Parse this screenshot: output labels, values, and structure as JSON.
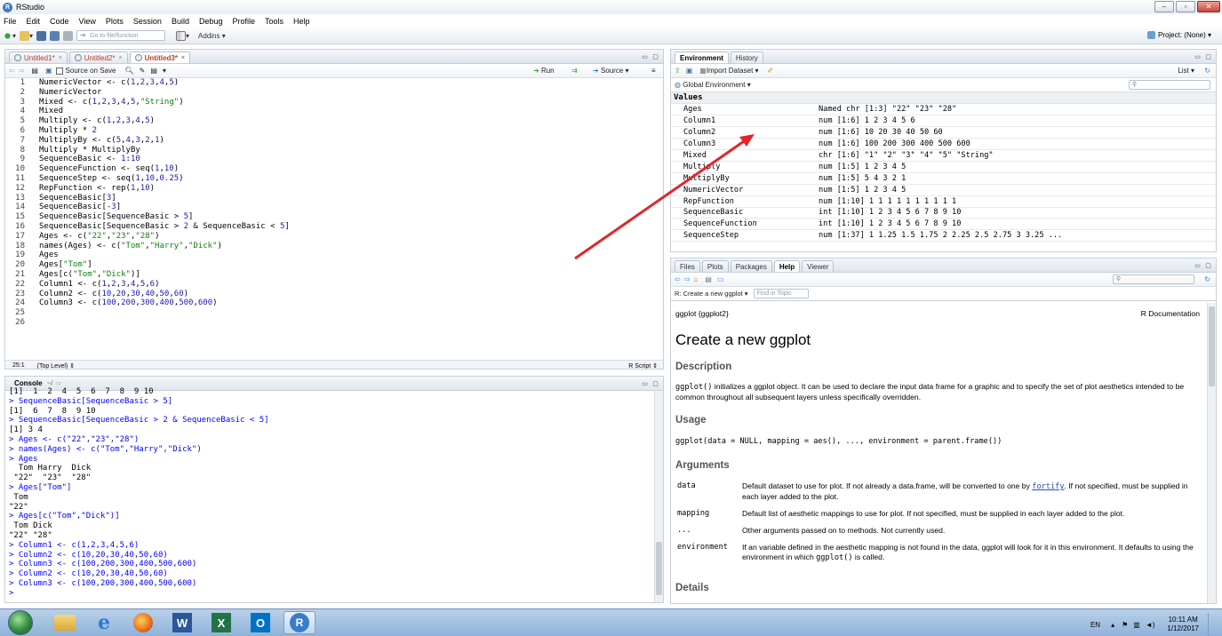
{
  "window": {
    "title": "RStudio",
    "buttons": {
      "min": "–",
      "max": "▫",
      "close": "✕"
    }
  },
  "menu": [
    "File",
    "Edit",
    "Code",
    "View",
    "Plots",
    "Session",
    "Build",
    "Debug",
    "Profile",
    "Tools",
    "Help"
  ],
  "toolbar": {
    "goto_placeholder": "Go to file/function",
    "addins": "Addins ▾",
    "project": "Project: (None) ▾"
  },
  "editor": {
    "tabs": [
      {
        "label": "Untitled1*",
        "active": false
      },
      {
        "label": "Untitled2*",
        "active": false
      },
      {
        "label": "Untitled3*",
        "active": true
      }
    ],
    "tab_close": "×",
    "toolbar": {
      "source_on_save": "Source on Save",
      "run": "Run",
      "source": "Source ▾"
    },
    "lines": [
      "NumericVector <- c(1,2,3,4,5)",
      "NumericVector",
      "Mixed <- c(1,2,3,4,5,\"String\")",
      "Mixed",
      "Multiply <- c(1,2,3,4,5)",
      "Multiply * 2",
      "MultiplyBy <- c(5,4,3,2,1)",
      "Multiply * MultiplyBy",
      "SequenceBasic <- 1:10",
      "SequenceFunction <- seq(1,10)",
      "SequenceStep <- seq(1,10,0.25)",
      "RepFunction <- rep(1,10)",
      "SequenceBasic[3]",
      "SequenceBasic[-3]",
      "SequenceBasic[SequenceBasic > 5]",
      "SequenceBasic[SequenceBasic > 2 & SequenceBasic < 5]",
      "Ages <- c(\"22\",\"23\",\"28\")",
      "names(Ages) <- c(\"Tom\",\"Harry\",\"Dick\")",
      "Ages",
      "Ages[\"Tom\"]",
      "Ages[c(\"Tom\",\"Dick\")]",
      "Column1 <- c(1,2,3,4,5,6)",
      "Column2 <- c(10,20,30,40,50,60)",
      "Column3 <- c(100,200,300,400,500,600)",
      "",
      ""
    ],
    "status": {
      "position": "25:1",
      "scope": "(Top Level) ⇕",
      "type": "R Script ⇕"
    }
  },
  "console": {
    "title": "Console",
    "path": "~/",
    "lines": [
      {
        "kind": "out",
        "text": "[1]  1  2  4  5  6  7  8  9 10"
      },
      {
        "kind": "cmd",
        "text": "> SequenceBasic[SequenceBasic > 5]"
      },
      {
        "kind": "out",
        "text": "[1]  6  7  8  9 10"
      },
      {
        "kind": "cmd",
        "text": "> SequenceBasic[SequenceBasic > 2 & SequenceBasic < 5]"
      },
      {
        "kind": "out",
        "text": "[1] 3 4"
      },
      {
        "kind": "cmd",
        "text": "> Ages <- c(\"22\",\"23\",\"28\")"
      },
      {
        "kind": "cmd",
        "text": "> names(Ages) <- c(\"Tom\",\"Harry\",\"Dick\")"
      },
      {
        "kind": "cmd",
        "text": "> Ages"
      },
      {
        "kind": "out",
        "text": "  Tom Harry  Dick"
      },
      {
        "kind": "out",
        "text": " \"22\"  \"23\"  \"28\""
      },
      {
        "kind": "cmd",
        "text": "> Ages[\"Tom\"]"
      },
      {
        "kind": "out",
        "text": " Tom"
      },
      {
        "kind": "out",
        "text": "\"22\""
      },
      {
        "kind": "cmd",
        "text": "> Ages[c(\"Tom\",\"Dick\")]"
      },
      {
        "kind": "out",
        "text": " Tom Dick"
      },
      {
        "kind": "out",
        "text": "\"22\" \"28\""
      },
      {
        "kind": "cmd",
        "text": "> Column1 <- c(1,2,3,4,5,6)"
      },
      {
        "kind": "cmd",
        "text": "> Column2 <- c(10,20,30,40,50,60)"
      },
      {
        "kind": "cmd",
        "text": "> Column3 <- c(100,200,300,400,500,600)"
      },
      {
        "kind": "cmd",
        "text": "> Column2 <- c(10,20,30,40,50,60)"
      },
      {
        "kind": "cmd",
        "text": "> Column3 <- c(100,200,300,400,500,600)"
      },
      {
        "kind": "cmd",
        "text": "> "
      }
    ]
  },
  "environment": {
    "tabs": [
      "Environment",
      "History"
    ],
    "import_dataset": "Import Dataset ▾",
    "list_view": "List ▾",
    "scope": "Global Environment ▾",
    "section": "Values",
    "rows": [
      {
        "name": "Ages",
        "value": "Named chr [1:3] \"22\" \"23\" \"28\""
      },
      {
        "name": "Column1",
        "value": "num [1:6] 1 2 3 4 5 6"
      },
      {
        "name": "Column2",
        "value": "num [1:6] 10 20 30 40 50 60"
      },
      {
        "name": "Column3",
        "value": "num [1:6] 100 200 300 400 500 600"
      },
      {
        "name": "Mixed",
        "value": "chr [1:6] \"1\" \"2\" \"3\" \"4\" \"5\" \"String\""
      },
      {
        "name": "Multiply",
        "value": "num [1:5] 1 2 3 4 5"
      },
      {
        "name": "MultiplyBy",
        "value": "num [1:5] 5 4 3 2 1"
      },
      {
        "name": "NumericVector",
        "value": "num [1:5] 1 2 3 4 5"
      },
      {
        "name": "RepFunction",
        "value": "num [1:10] 1 1 1 1 1 1 1 1 1 1"
      },
      {
        "name": "SequenceBasic",
        "value": "int [1:10] 1 2 3 4 5 6 7 8 9 10"
      },
      {
        "name": "SequenceFunction",
        "value": "int [1:10] 1 2 3 4 5 6 7 8 9 10"
      },
      {
        "name": "SequenceStep",
        "value": "num [1:37] 1 1.25 1.5 1.75 2 2.25 2.5 2.75 3 3.25 ..."
      }
    ]
  },
  "help": {
    "tabs": [
      "Files",
      "Plots",
      "Packages",
      "Help",
      "Viewer"
    ],
    "topic_select": "R: Create a new ggplot ▾",
    "find_placeholder": "Find in Topic",
    "header_left": "ggplot {ggplot2}",
    "header_right": "R Documentation",
    "title": "Create a new ggplot",
    "description_h": "Description",
    "description_code": "ggplot()",
    "description_text": " initializes a ggplot object. It can be used to declare the input data frame for a graphic and to specify the set of plot aesthetics intended to be common throughout all subsequent layers unless specifically overridden.",
    "usage_h": "Usage",
    "usage_code": "ggplot(data = NULL, mapping = aes(), ..., environment = parent.frame())",
    "arguments_h": "Arguments",
    "args": [
      {
        "name": "data",
        "pre": "Default dataset to use for plot. If not already a data.frame, will be converted to one by ",
        "link": "fortify",
        "post": ". If not specified, must be supplied in each layer added to the plot."
      },
      {
        "name": "mapping",
        "pre": "Default list of aesthetic mappings to use for plot. If not specified, must be supplied in each layer added to the plot.",
        "link": "",
        "post": ""
      },
      {
        "name": "...",
        "pre": "Other arguments passed on to methods. Not currently used.",
        "link": "",
        "post": ""
      },
      {
        "name": "environment",
        "pre": "If an variable defined in the aesthetic mapping is not found in the data, ggplot will look for it in this environment. It defaults to using the environment in which ",
        "link": "",
        "code": "ggplot()",
        "post": " is called."
      }
    ],
    "details_h": "Details"
  },
  "taskbar": {
    "lang": "EN",
    "time": "10:11 AM",
    "date": "1/12/2017"
  },
  "colors": {
    "annotation_arrow": "#e0262b",
    "keyword_blue": "#0000ff",
    "string_green": "#108010"
  }
}
